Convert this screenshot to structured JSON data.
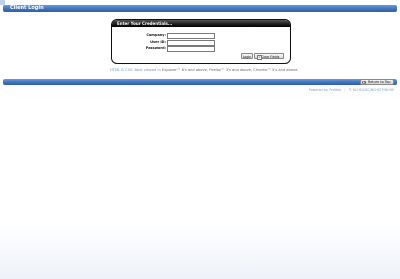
{
  "header": {
    "title": "Client Login"
  },
  "login": {
    "heading": "Enter Your Credentials...",
    "company_label": "Company:",
    "company_value": "",
    "user_label": "User ID:",
    "user_value": "",
    "password_label": "Password:",
    "password_value": "",
    "login_button": "Login",
    "clear_button": "Clear Fields"
  },
  "browser_note": {
    "prefix": "Best viewed in",
    "text": "Explorer™ 8's and above, Firefox™ 3's and above, Chrome™ 5's and above.",
    "lead": "HTML & CSS."
  },
  "return_top": {
    "label": "Return to Top"
  },
  "footer": {
    "powered": "Powered by: ProWeb",
    "sep": "|",
    "copyright": "© NCHS/CDC/NCHSTP/DHHS"
  }
}
